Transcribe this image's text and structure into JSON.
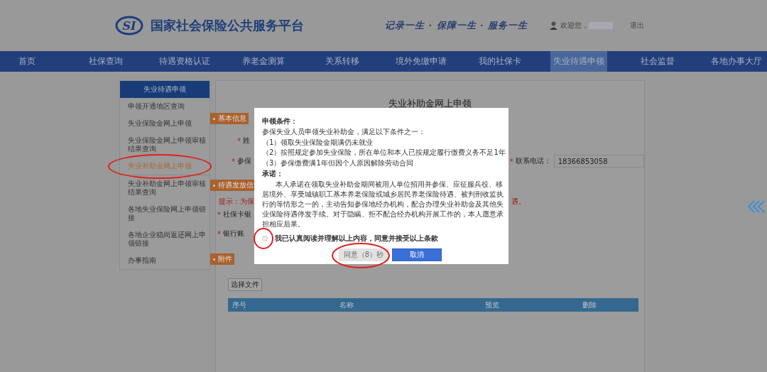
{
  "header": {
    "logo_mark": "SI",
    "site_name": "国家社会保险公共服务平台",
    "slogan": "记录一生 · 保障一生 · 服务一生",
    "greeting": "欢迎您，",
    "logout": "退出"
  },
  "nav": [
    {
      "label": "首页",
      "selected": false
    },
    {
      "label": "社保查询",
      "selected": false
    },
    {
      "label": "待遇资格认证",
      "selected": false
    },
    {
      "label": "养老金测算",
      "selected": false
    },
    {
      "label": "关系转移",
      "selected": false
    },
    {
      "label": "境外免缴申请",
      "selected": false
    },
    {
      "label": "我的社保卡",
      "selected": false
    },
    {
      "label": "失业待遇申领",
      "selected": true
    },
    {
      "label": "社会监督",
      "selected": false
    },
    {
      "label": "各地办事大厅",
      "selected": false
    }
  ],
  "sidebar": {
    "title": "失业待遇申领",
    "items": [
      {
        "label": "申领开通地区查询",
        "selected": false,
        "circled": false
      },
      {
        "label": "失业保险金网上申领",
        "selected": false,
        "circled": false
      },
      {
        "label": "失业保险金网上申领审核结果查询",
        "selected": false,
        "circled": false
      },
      {
        "label": "失业补助金网上申领",
        "selected": true,
        "circled": true
      },
      {
        "label": "失业补助金网上申领审核结果查询",
        "selected": false,
        "circled": false
      },
      {
        "label": "各地失业保险网上申领链接",
        "selected": false,
        "circled": false
      },
      {
        "label": "各地企业稳岗返还网上申领链接",
        "selected": false,
        "circled": false
      },
      {
        "label": "办事指南",
        "selected": false,
        "circled": false
      }
    ]
  },
  "form": {
    "title": "失业补助金网上申领",
    "basic_info": {
      "tag": "基本信息",
      "name_field": {
        "mark": "*",
        "label": "姓"
      },
      "insured_field": {
        "mark": "*",
        "label": "参保"
      },
      "phone_field": {
        "mark": "*",
        "label": "联系电话：",
        "value": "18366853058"
      }
    },
    "payment_info": {
      "tag": "待遇发放信",
      "hint": "提示：为保",
      "hint_tail": "遇。",
      "fields": [
        {
          "mark": "*",
          "label": "社保卡银"
        },
        {
          "mark": "*",
          "label": "银行账"
        }
      ]
    },
    "attachments": {
      "tag": "附件",
      "choose_button": "选择文件",
      "columns": [
        "序号",
        "名称",
        "预览",
        "删除"
      ]
    }
  },
  "modal": {
    "conditions_heading": "申领条件：",
    "conditions_intro": "参保失业人员申领失业补助金，满足以下条件之一：",
    "conditions": [
      {
        "number": "（1）",
        "text": "领取失业保险金期满仍未就业"
      },
      {
        "number": "（2）",
        "text": "按照规定参加失业保险，所在单位和本人已按规定履行缴费义务不足1年"
      },
      {
        "number": "（3）",
        "text": "参保缴费满1年但因个人原因解除劳动合同"
      }
    ],
    "pledge_heading": "承诺：",
    "pledge": "本人承诺在领取失业补助金期间被用人单位招用并参保、应征服兵役、移居境外、享受城镇职工基本养老保险或城乡居民养老保险待遇、被判刑收监执行的等情形之一的，主动告知参保地经办机构，配合办理失业补助金及其他失业保险待遇停发手续。对于隐瞒、拒不配合经办机构开展工作的，本人愿意承担相应后果。",
    "consent": {
      "label": "我已认真阅读并理解以上内容，同意并接受以上条款",
      "checked": false,
      "circled": true
    },
    "buttons": [
      {
        "label": "同意（8）秒",
        "kind": "primary",
        "disabled": true,
        "circled": true
      },
      {
        "label": "取消",
        "kind": "cancel",
        "disabled": false,
        "circled": false
      }
    ]
  }
}
